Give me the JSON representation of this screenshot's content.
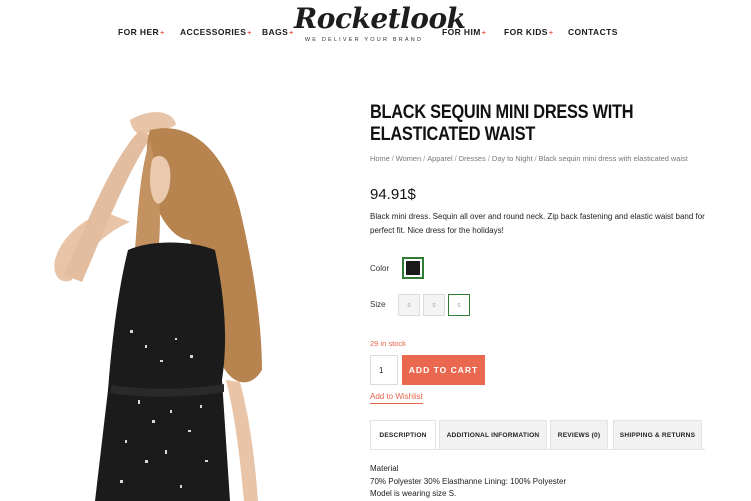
{
  "nav": {
    "items": [
      {
        "label": "FOR HER",
        "caret": "+"
      },
      {
        "label": "ACCESSORIES",
        "caret": "+"
      },
      {
        "label": "BAGS",
        "caret": "+"
      },
      {
        "label": "FOR HIM",
        "caret": "+"
      },
      {
        "label": "FOR KIDS",
        "caret": "+"
      },
      {
        "label": "CONTACTS",
        "caret": ""
      }
    ],
    "logo": {
      "name": "Rocketlook",
      "tagline": "WE DELIVER YOUR BRAND"
    }
  },
  "product": {
    "title": "BLACK SEQUIN MINI DRESS WITH ELASTICATED WAIST",
    "breadcrumb": [
      "Home",
      "Women",
      "Apparel",
      "Dresses",
      "Day to Night",
      "Black sequin mini dress with elasticated waist"
    ],
    "price": "94.91$",
    "description": "Black mini dress. Sequin all over and round neck. Zip back fastening and elastic waist band for perfect fit. Nice dress for the holidays!",
    "color_label": "Color",
    "color_value": "#1a1a1a",
    "size_label": "Size",
    "sizes": [
      "s",
      "s",
      "s"
    ],
    "stock": "29 in stock",
    "quantity": "1",
    "add_to_cart": "ADD TO CART",
    "wishlist": "Add to Wishlist"
  },
  "tabs": [
    "DESCRIPTION",
    "ADDITIONAL INFORMATION",
    "REVIEWS (0)",
    "SHIPPING & RETURNS"
  ],
  "tab_content": {
    "line1": "Material",
    "line2": "70% Polyester 30% Elasthanne Lining: 100% Polyester",
    "line3": "Model is wearing size S."
  },
  "colors": {
    "accent": "#e9684f",
    "selected_border": "#2e7d32"
  }
}
